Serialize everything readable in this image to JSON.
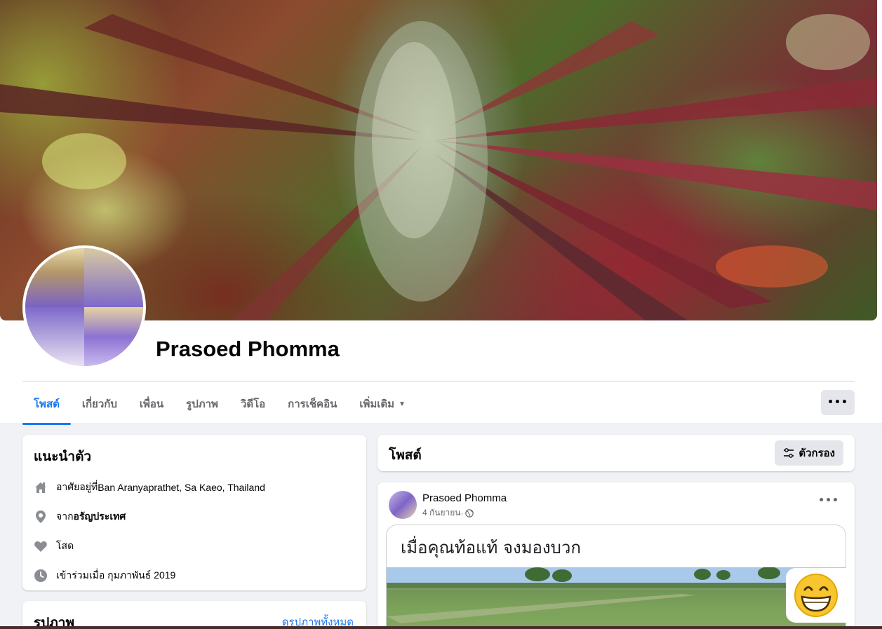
{
  "profile": {
    "name": "Prasoed Phomma"
  },
  "tabs": [
    {
      "label": "โพสต์"
    },
    {
      "label": "เกี่ยวกับ"
    },
    {
      "label": "เพื่อน"
    },
    {
      "label": "รูปภาพ"
    },
    {
      "label": "วิดีโอ"
    },
    {
      "label": "การเช็คอิน"
    },
    {
      "label": "เพิ่มเติม"
    }
  ],
  "more_button": "•••",
  "intro": {
    "title": "แนะนำตัว",
    "lives_in_prefix": "อาศัยอยู่ที่ ",
    "lives_in": "Ban Aranyaprathet, Sa Kaeo, Thailand",
    "from_prefix": "จาก ",
    "from": "อรัญประเทศ",
    "relationship": "โสด",
    "joined": "เข้าร่วมเมื่อ กุมภาพันธ์ 2019"
  },
  "photos": {
    "title": "รูปภาพ",
    "see_all": "ดูรูปภาพทั้งหมด"
  },
  "posts": {
    "title": "โพสต์",
    "filter_label": "ตัวกรอง"
  },
  "post": {
    "author": "Prasoed Phomma",
    "date": "4 กันยายน",
    "separator": " · ",
    "more": "•••",
    "meme_text": "เมื่อคุณท้อแท้ จงมองบวก"
  },
  "colors": {
    "accent": "#1877f2",
    "background": "#f0f2f5"
  }
}
